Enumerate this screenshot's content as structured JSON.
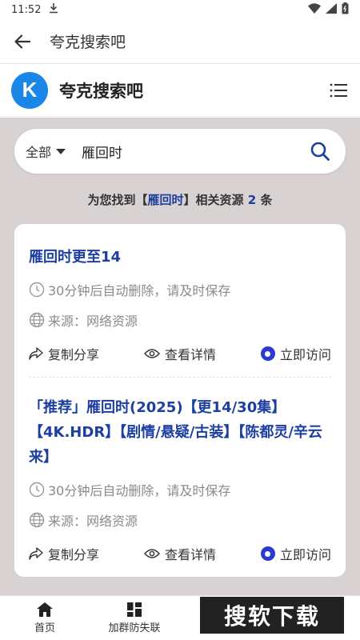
{
  "status": {
    "time": "11:52"
  },
  "appbar": {
    "title": "夸克搜索吧"
  },
  "site": {
    "logo_letter": "K",
    "name": "夸克搜索吧"
  },
  "search": {
    "scope": "全部",
    "query": "雁回时"
  },
  "summary": {
    "prefix": "为您找到【",
    "keyword": "雁回时",
    "middle": "】相关资源",
    "count": "2",
    "suffix": "条"
  },
  "results": [
    {
      "title": "雁回时更至14",
      "expire": "30分钟后自动删除，请及时保存",
      "source": "来源：网络资源",
      "share": "复制分享",
      "details": "查看详情",
      "visit": "立即访问"
    },
    {
      "title": "「推荐」雁回时(2025)【更14/30集】【4K.HDR】【剧情/悬疑/古装】【陈都灵/辛云来】",
      "expire": "30分钟后自动删除，请及时保存",
      "source": "来源：网络资源",
      "share": "复制分享",
      "details": "查看详情",
      "visit": "立即访问"
    }
  ],
  "bottom_nav": [
    {
      "label": "首页",
      "icon": "home-icon"
    },
    {
      "label": "加群防失联",
      "icon": "grid-icon"
    }
  ],
  "watermark": "搜软下载",
  "colors": {
    "accent": "#1d3fa0",
    "logo_bg": "#1a86e8",
    "page_bg": "#d9d2d2",
    "visit_dot": "#2b3ad0"
  }
}
